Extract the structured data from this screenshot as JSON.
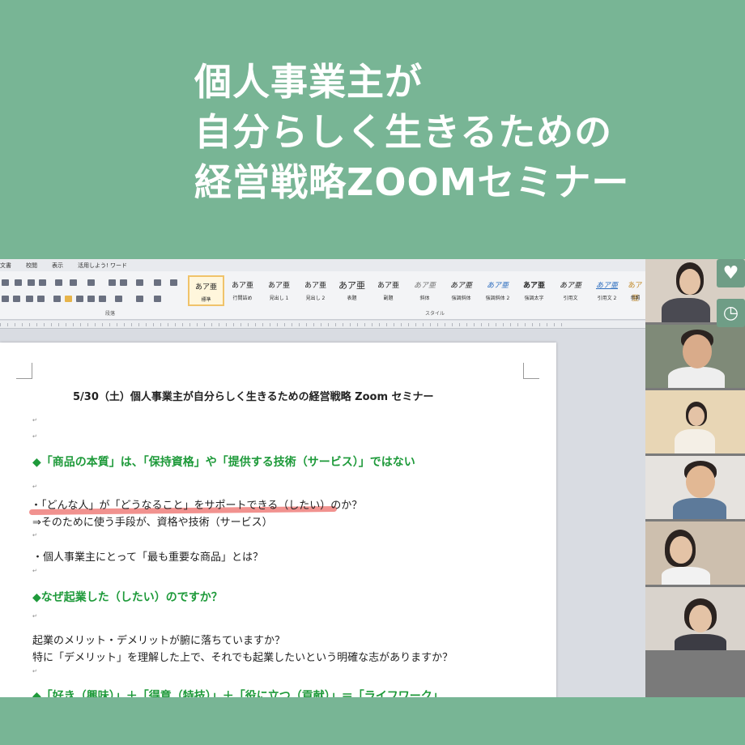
{
  "banner": {
    "line1": "個人事業主が",
    "line2": "自分らしく生きるための",
    "line3": "経営戦略ZOOMセミナー"
  },
  "ribbon": {
    "tabs": [
      "文書",
      "校閲",
      "表示",
      "活用しよう! ワード"
    ],
    "group_paragraph": "段落",
    "group_style": "スタイル",
    "styles": [
      {
        "glyph": "あア亜",
        "name": "標準"
      },
      {
        "glyph": "あア亜",
        "name": "行間詰め"
      },
      {
        "glyph": "あア亜",
        "name": "見出し 1"
      },
      {
        "glyph": "あア亜",
        "name": "見出し 2"
      },
      {
        "glyph": "あア亜",
        "name": "表題"
      },
      {
        "glyph": "あア亜",
        "name": "副題"
      },
      {
        "glyph": "あア亜",
        "name": "斜体"
      },
      {
        "glyph": "あア亜",
        "name": "強調斜体"
      },
      {
        "glyph": "あア亜",
        "name": "強調斜体 2"
      },
      {
        "glyph": "あア亜",
        "name": "強調太字"
      },
      {
        "glyph": "あア亜",
        "name": "引用文"
      },
      {
        "glyph": "あア亜",
        "name": "引用文 2"
      },
      {
        "glyph": "あア亜",
        "name": "参照"
      }
    ]
  },
  "document": {
    "title": "5/30（土）個人事業主が自分らしく生きるための経営戦略 Zoom セミナー",
    "heading1": "◆「商品の本質」は、「保持資格」や「提供する技術（サービス）」ではない",
    "point1": "・「どんな人」が「どうなること」をサポートできる（したい）のか？",
    "point2": "⇒そのために使う手段が、資格や技術（サービス）",
    "point3": "・個人事業主にとって「最も重要な商品」とは？",
    "heading2": "◆なぜ起業した（したい）のですか？",
    "point4": "起業のメリット・デメリットが腑に落ちていますか？",
    "point5": "特に「デメリット」を理解した上で、それでも起業したいという明確な志がありますか？",
    "heading3": "◆「好き（興味）」＋「得意（特技）」＋「役に立つ（貢献）」＝「ライフワーク」"
  },
  "video": {
    "participants": [
      {
        "label": "participant-1"
      },
      {
        "label": "participant-2"
      },
      {
        "label": "participant-3"
      },
      {
        "label": "participant-4"
      },
      {
        "label": "participant-5"
      },
      {
        "label": "participant-6"
      }
    ],
    "heart_icon": "♥",
    "clock_icon": "◷"
  },
  "colors": {
    "background": "#78b595",
    "heading_green": "#1e9a3a",
    "highlight": "#ef7f7b"
  }
}
